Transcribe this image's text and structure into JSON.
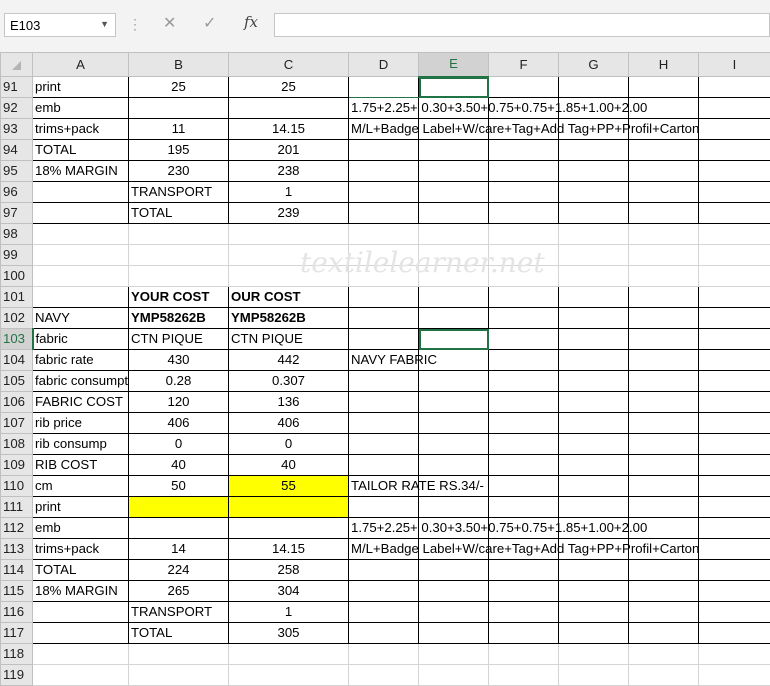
{
  "name_box": "E103",
  "formula_bar": {
    "cancel_icon": "✕",
    "enter_icon": "✓",
    "fx_label": "fx",
    "value": ""
  },
  "columns": [
    "A",
    "B",
    "C",
    "D",
    "E",
    "F",
    "G",
    "H",
    "I"
  ],
  "watermark": "textilelearner.net",
  "rows": [
    {
      "n": "91",
      "a": "print",
      "b": "25",
      "c": "25",
      "d": ""
    },
    {
      "n": "92",
      "a": "emb",
      "b": "",
      "c": "",
      "d": "1.75+2.25+ 0.30+3.50+0.75+0.75+1.85+1.00+2.00"
    },
    {
      "n": "93",
      "a": "trims+pack",
      "b": "11",
      "c": "14.15",
      "d": "M/L+Badge Label+W/care+Tag+Add Tag+PP+Profil+Carton"
    },
    {
      "n": "94",
      "a": "TOTAL",
      "b": "195",
      "c": "201",
      "d": ""
    },
    {
      "n": "95",
      "a": "18% MARGIN",
      "b": "230",
      "c": "238",
      "d": ""
    },
    {
      "n": "96",
      "a": "",
      "b": "TRANSPORT",
      "c": "1",
      "d": ""
    },
    {
      "n": "97",
      "a": "",
      "b": "TOTAL",
      "c": "239",
      "d": ""
    },
    {
      "n": "98",
      "a": "",
      "b": "",
      "c": "",
      "d": ""
    },
    {
      "n": "99",
      "a": "",
      "b": "",
      "c": "",
      "d": ""
    },
    {
      "n": "100",
      "a": "",
      "b": "",
      "c": "",
      "d": ""
    },
    {
      "n": "101",
      "a": "",
      "b": "YOUR COST",
      "c": "OUR COST",
      "d": ""
    },
    {
      "n": "102",
      "a": "NAVY",
      "b": "YMP58262B",
      "c": "YMP58262B",
      "d": ""
    },
    {
      "n": "103",
      "a": "fabric",
      "b": "CTN PIQUE",
      "c": "CTN PIQUE",
      "d": ""
    },
    {
      "n": "104",
      "a": "fabric rate",
      "b": "430",
      "c": "442",
      "d": "NAVY FABRIC"
    },
    {
      "n": "105",
      "a": "fabric consumption",
      "b": "0.28",
      "c": "0.307",
      "d": ""
    },
    {
      "n": "106",
      "a": "FABRIC COST",
      "b": "120",
      "c": "136",
      "d": ""
    },
    {
      "n": "107",
      "a": "rib price",
      "b": "406",
      "c": "406",
      "d": ""
    },
    {
      "n": "108",
      "a": "rib consump",
      "b": "0",
      "c": "0",
      "d": ""
    },
    {
      "n": "109",
      "a": "RIB COST",
      "b": "40",
      "c": "40",
      "d": ""
    },
    {
      "n": "110",
      "a": "cm",
      "b": "50",
      "c": "55",
      "d": "TAILOR RATE RS.34/-"
    },
    {
      "n": "111",
      "a": "print",
      "b": "",
      "c": "",
      "d": ""
    },
    {
      "n": "112",
      "a": "emb",
      "b": "",
      "c": "",
      "d": "1.75+2.25+ 0.30+3.50+0.75+0.75+1.85+1.00+2.00"
    },
    {
      "n": "113",
      "a": "trims+pack",
      "b": "14",
      "c": "14.15",
      "d": "M/L+Badge Label+W/care+Tag+Add Tag+PP+Profil+Carton"
    },
    {
      "n": "114",
      "a": "TOTAL",
      "b": "224",
      "c": "258",
      "d": ""
    },
    {
      "n": "115",
      "a": "18% MARGIN",
      "b": "265",
      "c": "304",
      "d": ""
    },
    {
      "n": "116",
      "a": "",
      "b": "TRANSPORT",
      "c": "1",
      "d": ""
    },
    {
      "n": "117",
      "a": "",
      "b": "TOTAL",
      "c": "305",
      "d": ""
    },
    {
      "n": "118",
      "a": "",
      "b": "",
      "c": "",
      "d": ""
    },
    {
      "n": "119",
      "a": "",
      "b": "",
      "c": "",
      "d": ""
    }
  ]
}
